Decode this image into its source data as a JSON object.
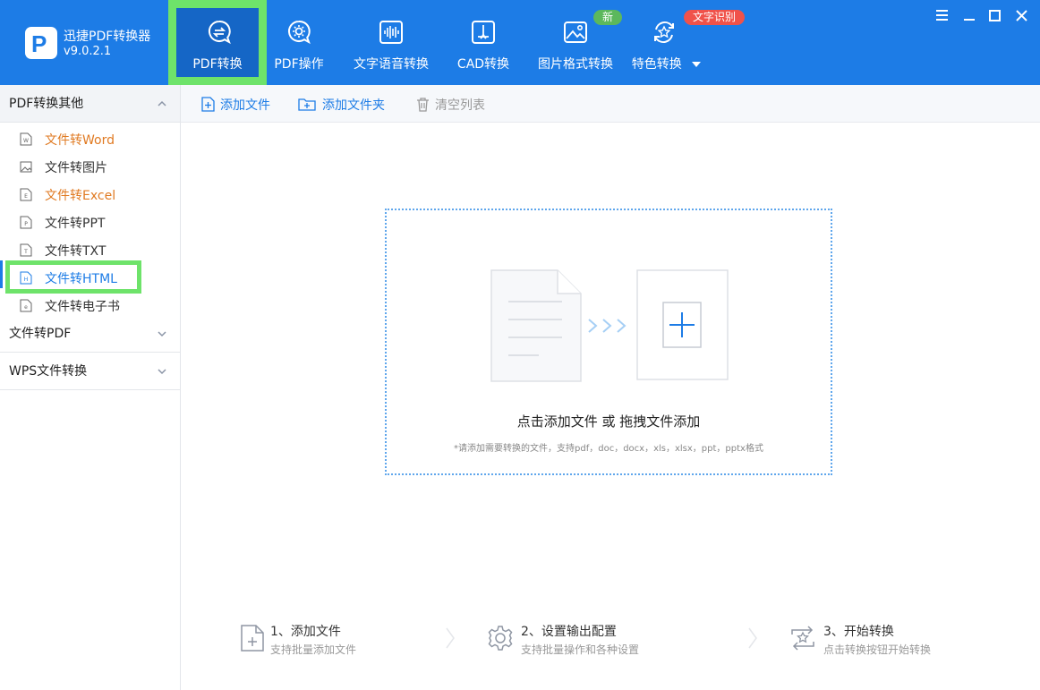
{
  "app": {
    "name": "迅捷PDF转换器",
    "version": "v9.0.2.1",
    "logo_letter": "P"
  },
  "nav": {
    "tabs": [
      {
        "label": "PDF转换",
        "icon": "pdf-convert-icon",
        "active": true
      },
      {
        "label": "PDF操作",
        "icon": "pdf-ops-icon"
      },
      {
        "label": "文字语音转换",
        "icon": "audio-wave-icon"
      },
      {
        "label": "CAD转换",
        "icon": "cad-icon"
      },
      {
        "label": "图片格式转换",
        "icon": "image-icon"
      },
      {
        "label": "特色转换",
        "icon": "star-cycle-icon"
      }
    ],
    "badge_new": "新",
    "badge_ocr": "文字识别"
  },
  "sidebar": {
    "groups": [
      {
        "label": "PDF转换其他",
        "expanded": true
      },
      {
        "label": "文件转PDF",
        "expanded": false
      },
      {
        "label": "WPS文件转换",
        "expanded": false
      }
    ],
    "items": [
      {
        "label": "文件转Word",
        "icon_letter": "W",
        "style": "orange"
      },
      {
        "label": "文件转图片",
        "icon_letter": "",
        "style": "normal"
      },
      {
        "label": "文件转Excel",
        "icon_letter": "E",
        "style": "orange"
      },
      {
        "label": "文件转PPT",
        "icon_letter": "P",
        "style": "normal"
      },
      {
        "label": "文件转TXT",
        "icon_letter": "T",
        "style": "normal"
      },
      {
        "label": "文件转HTML",
        "icon_letter": "H",
        "style": "active"
      },
      {
        "label": "文件转电子书",
        "icon_letter": "e",
        "style": "normal"
      }
    ]
  },
  "toolbar": {
    "add_file": "添加文件",
    "add_folder": "添加文件夹",
    "clear_list": "清空列表"
  },
  "dropzone": {
    "title": "点击添加文件 或 拖拽文件添加",
    "hint": "*请添加需要转换的文件，支持pdf，doc，docx，xls，xlsx，ppt，pptx格式"
  },
  "steps": [
    {
      "title": "1、添加文件",
      "subtitle": "支持批量添加文件"
    },
    {
      "title": "2、设置输出配置",
      "subtitle": "支持批量操作和各种设置"
    },
    {
      "title": "3、开始转换",
      "subtitle": "点击转换按钮开始转换"
    }
  ],
  "colors": {
    "brand_blue": "#1d7ce6",
    "active_tab": "#1566c6",
    "highlight_green": "#6ee36a",
    "orange_text": "#e07a22",
    "badge_green": "#5cb85c",
    "badge_red": "#f0524a"
  }
}
